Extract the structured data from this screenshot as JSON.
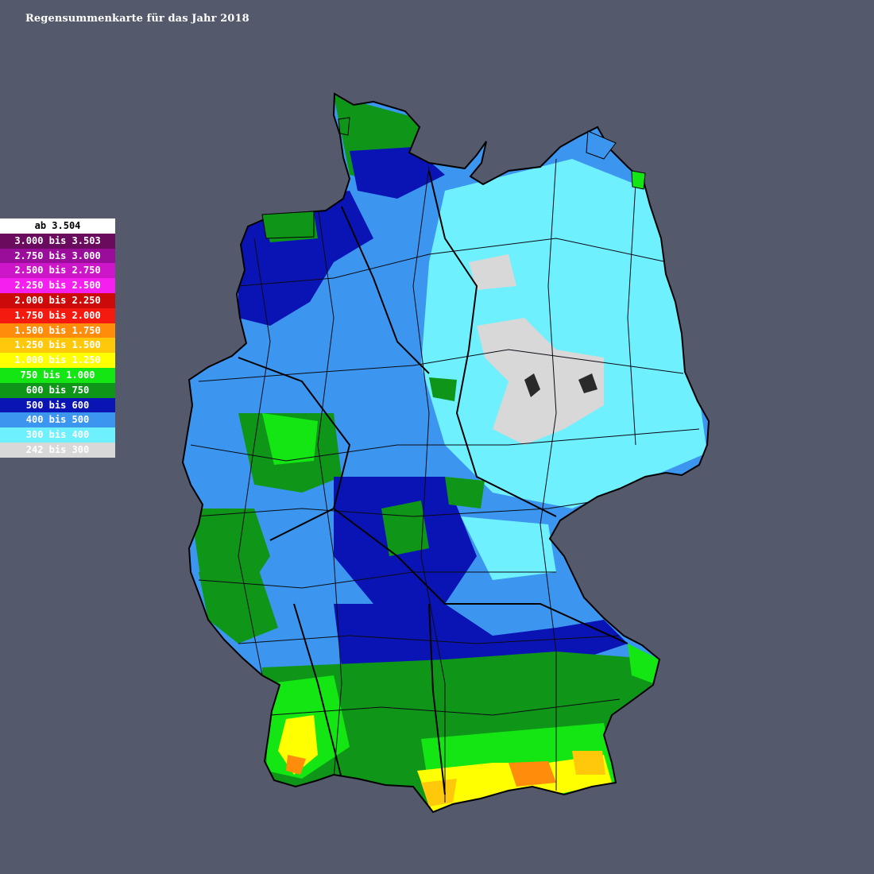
{
  "title": "Regensummenkarte für das Jahr 2018",
  "legend": [
    {
      "label": "ab 3.504",
      "color": "#ffffff",
      "text_color": "#000000"
    },
    {
      "label": "3.000 bis 3.503",
      "color": "#6a0c5e",
      "text_color": "#ffffff"
    },
    {
      "label": "2.750 bis 3.000",
      "color": "#9a0d9a",
      "text_color": "#ffffff"
    },
    {
      "label": "2.500 bis 2.750",
      "color": "#cc16c8",
      "text_color": "#ffffff"
    },
    {
      "label": "2.250 bis 2.500",
      "color": "#f51ff0",
      "text_color": "#ffffff"
    },
    {
      "label": "2.000 bis 2.250",
      "color": "#cc0a0a",
      "text_color": "#ffffff"
    },
    {
      "label": "1.750 bis 2.000",
      "color": "#f51a0f",
      "text_color": "#ffffff"
    },
    {
      "label": "1.500 bis 1.750",
      "color": "#ff8c0a",
      "text_color": "#ffffff"
    },
    {
      "label": "1.250 bis 1.500",
      "color": "#ffc80a",
      "text_color": "#ffffff"
    },
    {
      "label": "1.000 bis 1.250",
      "color": "#ffff00",
      "text_color": "#ffffff"
    },
    {
      "label": "750 bis 1.000",
      "color": "#14e614",
      "text_color": "#ffffff"
    },
    {
      "label": "600 bis 750",
      "color": "#0f9619",
      "text_color": "#ffffff"
    },
    {
      "label": "500 bis 600",
      "color": "#0a14b4",
      "text_color": "#ffffff"
    },
    {
      "label": "400 bis 500",
      "color": "#3c96f0",
      "text_color": "#ffffff"
    },
    {
      "label": "300 bis 400",
      "color": "#6ef0ff",
      "text_color": "#ffffff"
    },
    {
      "label": "242 bis 300",
      "color": "#d8d8d8",
      "text_color": "#ffffff"
    }
  ]
}
